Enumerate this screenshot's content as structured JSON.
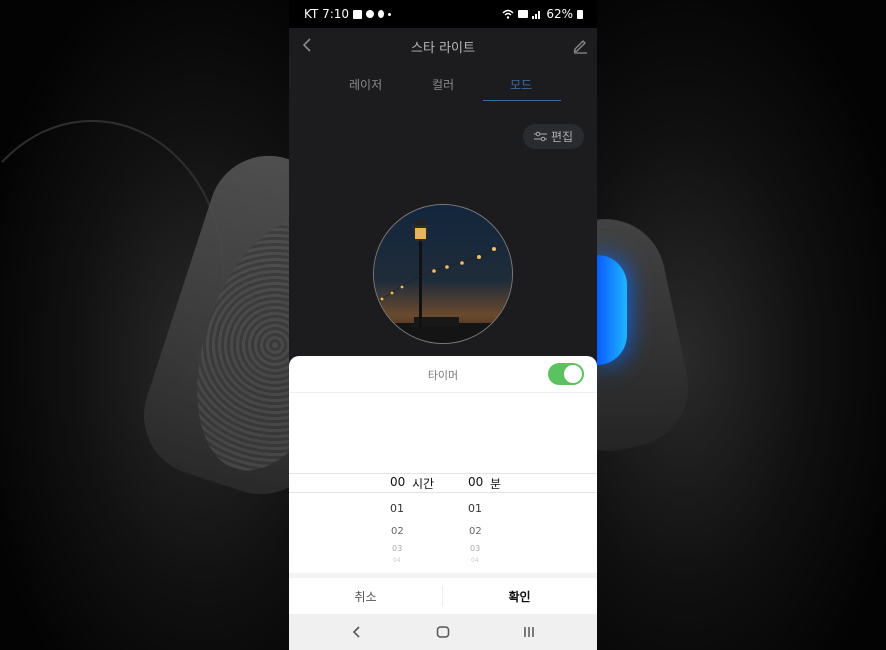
{
  "status_bar": {
    "carrier_time": "KT 7:10",
    "battery": "62%",
    "icons": [
      "image-icon",
      "message-icon",
      "mic-off-icon",
      "wifi-icon",
      "volte-icon",
      "signal-icon",
      "battery-icon"
    ]
  },
  "header": {
    "title": "스타 라이트",
    "back_icon": "chevron-left-icon",
    "edit_icon": "pencil-icon"
  },
  "tabs": [
    {
      "label": "레이저",
      "active": false
    },
    {
      "label": "컬러",
      "active": false
    },
    {
      "label": "모드",
      "active": true
    }
  ],
  "edit_button": {
    "label": "편집",
    "icon": "sliders-icon"
  },
  "timer_sheet": {
    "title": "타이머",
    "toggle_on": true,
    "hours": {
      "selected": "00",
      "unit": "시간",
      "next": [
        "01",
        "02",
        "03",
        "04"
      ]
    },
    "minutes": {
      "selected": "00",
      "unit": "분",
      "next": [
        "01",
        "02",
        "03",
        "04"
      ]
    },
    "cancel_label": "취소",
    "confirm_label": "확인"
  },
  "nav_bar": {
    "icons": [
      "back-icon",
      "home-icon",
      "recents-icon"
    ]
  },
  "colors": {
    "accent": "#3c6a9e",
    "toggle": "#5ac25e",
    "sheet": "#ffffff"
  }
}
